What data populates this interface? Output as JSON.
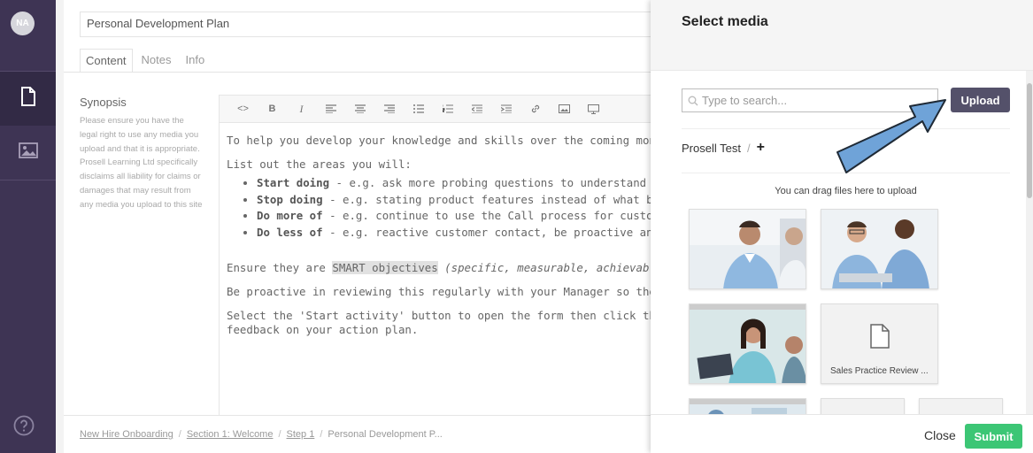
{
  "user": {
    "initials": "NA"
  },
  "page": {
    "title_value": "Personal Development Plan",
    "tabs": [
      {
        "label": "Content"
      },
      {
        "label": "Notes"
      },
      {
        "label": "Info"
      }
    ],
    "synopsis": {
      "heading": "Synopsis",
      "text": "Please ensure you have the legal right to use any media you upload and that it is appropriate. Prosell Learning Ltd specifically disclaims all liability for claims or damages that may result from any media you upload to this site"
    },
    "editor": {
      "intro": "To help you develop your knowledge and skills over the coming months, you w",
      "list_intro": "List out the areas you will:",
      "items": [
        {
          "bold": "Start doing",
          "rest": " - e.g. ask more probing questions to understand a custome"
        },
        {
          "bold": "Stop doing",
          "rest": " - e.g. stating product features instead of what benefit they"
        },
        {
          "bold": "Do more of",
          "rest": " - e.g. continue to use the Call process for customer contact"
        },
        {
          "bold": "Do less of",
          "rest": " - e.g. reactive customer contact, be proactive and contact cu"
        }
      ],
      "smart_pre": "Ensure they are ",
      "smart_hl": "SMART objectives",
      "smart_post": " (specific, measurable, achievable, realistic",
      "proactive": "Be proactive in reviewing this regularly with your Manager so they can suppor",
      "select_line1": "Select the 'Start activity' button to open the form then click the 'Submit' butto",
      "select_line2": "feedback on your action plan."
    },
    "breadcrumb": [
      {
        "label": "New Hire Onboarding"
      },
      {
        "label": "Section 1: Welcome"
      },
      {
        "label": "Step 1"
      },
      {
        "label": "Personal Development P..."
      }
    ]
  },
  "media_panel": {
    "title": "Select media",
    "search_placeholder": "Type to search...",
    "upload_label": "Upload",
    "folder": "Prosell Test",
    "folder_sep": "/",
    "add_label": "+",
    "drag_hint": "You can drag files here to upload",
    "document_label": "Sales Practice Review ...",
    "close_label": "Close",
    "submit_label": "Submit"
  },
  "colors": {
    "nav": "#3e3454",
    "upload": "#54516a",
    "submit": "#3cc675",
    "arrow": "#6fa3d8"
  }
}
